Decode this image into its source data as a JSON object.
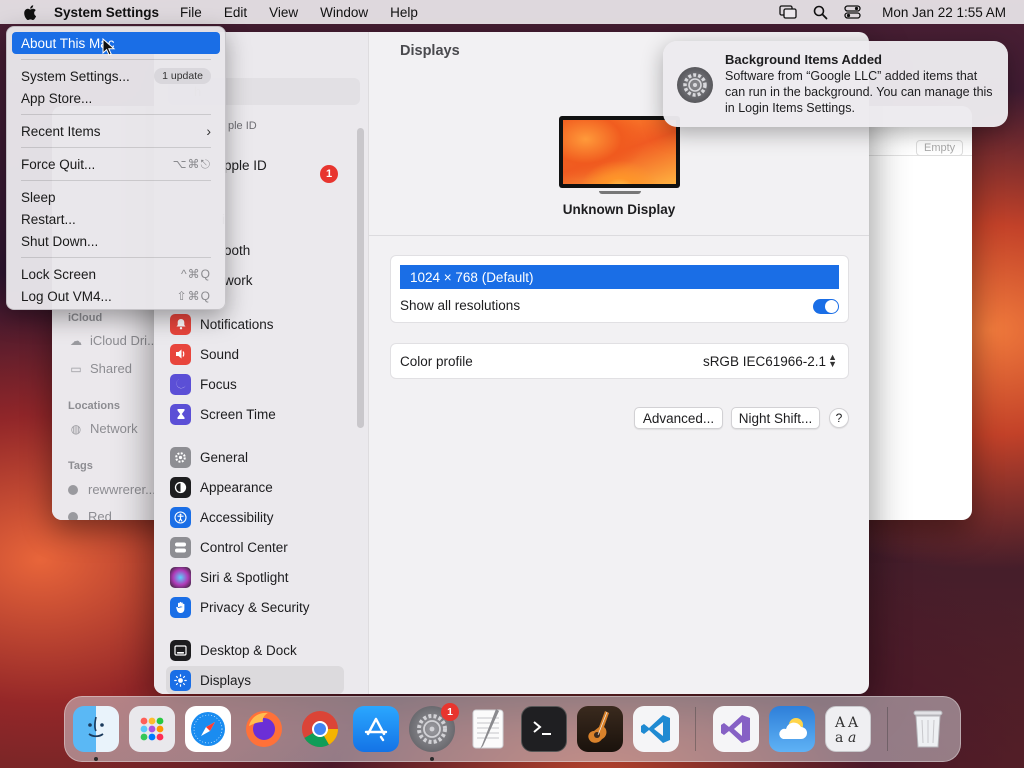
{
  "menubar": {
    "app_name": "System Settings",
    "menus": [
      "File",
      "Edit",
      "View",
      "Window",
      "Help"
    ],
    "clock": "Mon Jan 22  1:55 AM",
    "status_icons": [
      "screen-mirroring-icon",
      "search-icon",
      "control-center-icon"
    ]
  },
  "apple_menu": {
    "about": "About This Mac",
    "system_settings": "System Settings...",
    "update_badge": "1 update",
    "app_store": "App Store...",
    "recent_items": "Recent Items",
    "force_quit": "Force Quit...",
    "force_quit_shortcut": "⌥⌘⎋",
    "sleep": "Sleep",
    "restart": "Restart...",
    "shut_down": "Shut Down...",
    "lock_screen": "Lock Screen",
    "lock_screen_shortcut": "^⌘Q",
    "log_out": "Log Out VM4...",
    "log_out_shortcut": "⇧⌘Q"
  },
  "finder": {
    "icloud_head": "iCloud",
    "icloud_drive": "iCloud Dri...",
    "shared": "Shared",
    "locations_head": "Locations",
    "network": "Network",
    "tags_head": "Tags",
    "tag1": "rewwrerer...",
    "tag2": "Red",
    "empty_chip": "Empty"
  },
  "settings": {
    "search_placeholder": "h",
    "apple_id_small": "ple ID",
    "apple_id": "pple ID",
    "apple_id_badge": "1",
    "partial_wifi": "i",
    "partial_bluetooth": "ooth",
    "partial_network": "work",
    "sidebar": [
      {
        "label": "Notifications",
        "icon": "bell-icon",
        "color": "#e8453c"
      },
      {
        "label": "Sound",
        "icon": "speaker-icon",
        "color": "#e8453c"
      },
      {
        "label": "Focus",
        "icon": "moon-icon",
        "color": "#5b4fd6"
      },
      {
        "label": "Screen Time",
        "icon": "hourglass-icon",
        "color": "#5b4fd6"
      },
      {
        "label": "General",
        "icon": "gear-icon",
        "color": "#8e8e93"
      },
      {
        "label": "Appearance",
        "icon": "appearance-icon",
        "color": "#1d1d1f"
      },
      {
        "label": "Accessibility",
        "icon": "accessibility-icon",
        "color": "#1a6ee6"
      },
      {
        "label": "Control Center",
        "icon": "control-center-icon",
        "color": "#8e8e93"
      },
      {
        "label": "Siri & Spotlight",
        "icon": "siri-icon",
        "color": "#b03ab8"
      },
      {
        "label": "Privacy & Security",
        "icon": "hand-icon",
        "color": "#1a6ee6"
      },
      {
        "label": "Desktop & Dock",
        "icon": "dock-icon",
        "color": "#1d1d1f"
      },
      {
        "label": "Displays",
        "icon": "sun-icon",
        "color": "#1a6ee6"
      }
    ],
    "main": {
      "title": "Displays",
      "display_name": "Unknown Display",
      "resolution": "1024 × 768 (Default)",
      "show_all_resolutions": "Show all resolutions",
      "show_all_resolutions_on": true,
      "color_profile_label": "Color profile",
      "color_profile_value": "sRGB IEC61966-2.1",
      "advanced_button": "Advanced...",
      "night_shift_button": "Night Shift...",
      "help_button": "?"
    }
  },
  "notification": {
    "title": "Background Items Added",
    "body": "Software from “Google LLC” added items that can run in the background. You can manage this in Login Items Settings."
  },
  "dock": {
    "settings_badge": "1",
    "apps": [
      "finder-icon",
      "launchpad-icon",
      "safari-icon",
      "firefox-icon",
      "chrome-icon",
      "app-store-icon",
      "system-settings-icon",
      "textedit-icon",
      "terminal-icon",
      "garageband-icon",
      "vscode-icon",
      "visual-studio-icon",
      "weather-icon",
      "font-book-icon",
      "trash-icon"
    ]
  }
}
